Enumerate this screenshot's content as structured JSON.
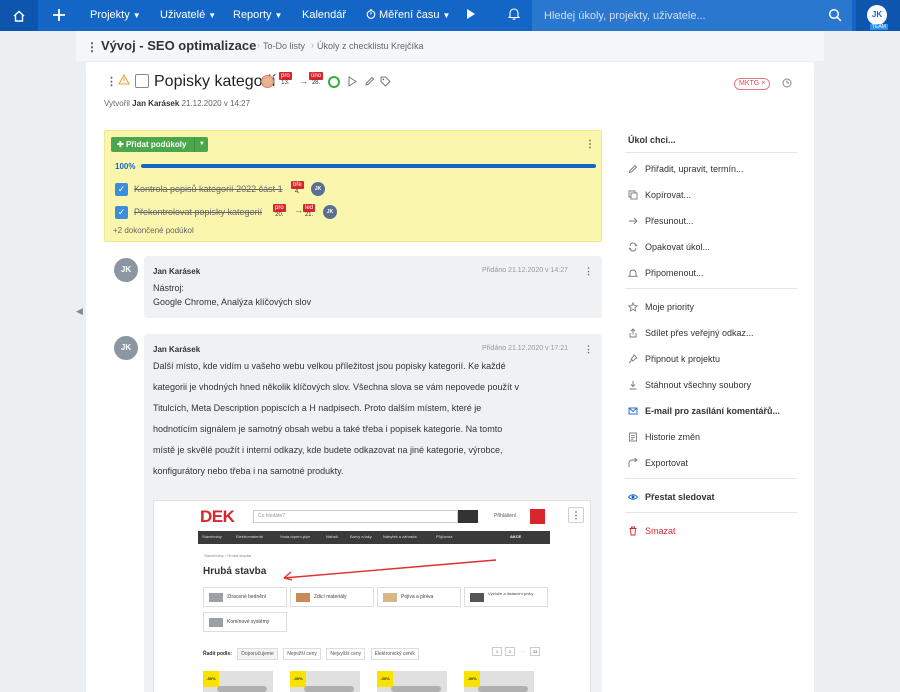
{
  "topbar": {
    "nav": [
      {
        "label": "Projekty",
        "has_menu": true
      },
      {
        "label": "Uživatelé",
        "has_menu": true
      },
      {
        "label": "Reporty",
        "has_menu": true
      },
      {
        "label": "Kalendář",
        "has_menu": false
      },
      {
        "label": "Měření času",
        "has_menu": true
      }
    ],
    "search_placeholder": "Hledej úkoly, projekty, uživatele...",
    "user_initials": "JK",
    "user_badge": "TEAM",
    "colors": {
      "bar": "#1466c6",
      "dark": "#0d55ad"
    }
  },
  "breadcrumb": {
    "title": "Vývoj - SEO optimalizace",
    "links": [
      "To-Do listy",
      "Úkoly z checklistu Krejčíka"
    ]
  },
  "task": {
    "title": "Popisky kategorií",
    "start": {
      "month": "pro",
      "day": "13."
    },
    "end": {
      "month": "úno",
      "day": "28."
    },
    "badge": "MKTG",
    "created_prefix": "Vytvořil",
    "created_by": "Jan Karásek",
    "created_at": "21.12.2020 v 14:27"
  },
  "subtasks": {
    "add_label": "Přidat podúkoly",
    "progress_label": "100%",
    "progress": 1.0,
    "items": [
      {
        "label": "Kontrola popisů kategorií 2022 část 1",
        "done": true,
        "date_month": "bře",
        "date_day": "4.",
        "assignee": "JK"
      },
      {
        "label": "Překontrolovat popisky kategorií",
        "done": true,
        "start_month": "pro",
        "start_day": "20.",
        "date_month": "led",
        "date_day": "21.",
        "assignee": "JK"
      }
    ],
    "more": "+2 dokončené podúkol"
  },
  "comments": [
    {
      "author": "Jan Karásek",
      "initials": "JK",
      "date": "Přidáno 21.12.2020 v 14:27",
      "lines": [
        "Nástroj:",
        "Google Chrome, Analýza klíčových slov"
      ]
    },
    {
      "author": "Jan Karásek",
      "initials": "JK",
      "date": "Přidáno 21.12.2020 v 17:21",
      "lines": [
        "Další místo, kde vidím u vašeho webu velkou příležitost jsou popisky kategorií. Ke každé",
        "kategorii je vhodných hned několik klíčových slov. Všechna slova se vám nepovede použít v",
        "Titulcích, Meta Description popiscích a H nadpisech. Proto dalším místem, které je",
        "hodnotícím signálem je samotný obsah webu a také třeba i popisek kategorie. Na tomto",
        "místě je skvělé použít i interní odkazy, kde budete odkazovat na jiné kategorie, výrobce,",
        "konfigurátory nebo třeba i na samotné produkty."
      ]
    }
  ],
  "attachment": {
    "logo": "DEK",
    "search_placeholder": "Co hledáte?",
    "login": "Přihlášení",
    "nav": [
      "Stavebniny",
      "Elektromateriál",
      "Voda-topení-plyn",
      "Nářadí",
      "Barvy a laky",
      "Nábytek a zahrada",
      "Půjčovna",
      "AKCE"
    ],
    "crumb": "Stavebniny  ›  Hrubá stavba",
    "heading": "Hrubá stavba",
    "tiles": [
      "Ztracené bednění",
      "Zdicí materiály",
      "Pojiva a plniva",
      "Výztuže a distanční prvky",
      "Komínové systémy"
    ],
    "sort_label": "Řadit podle:",
    "sort_options": [
      "Doporučujeme",
      "Nejnižší ceny",
      "Nejvyšší ceny",
      "Elektronický ceník"
    ],
    "pager": [
      "1",
      "2",
      "...",
      "33"
    ],
    "sale_label": "-30%"
  },
  "sidebar": {
    "heading": "Úkol chci...",
    "groups": [
      [
        {
          "label": "Přiřadit, upravit, termín...",
          "icon": "pencil-icon"
        },
        {
          "label": "Kopírovat...",
          "icon": "copy-icon"
        },
        {
          "label": "Přesunout...",
          "icon": "arrow-right-icon"
        },
        {
          "label": "Opakovat úkol...",
          "icon": "repeat-icon"
        },
        {
          "label": "Připomenout...",
          "icon": "bell-icon"
        }
      ],
      [
        {
          "label": "Moje priority",
          "icon": "star-icon"
        },
        {
          "label": "Sdílet přes veřejný odkaz...",
          "icon": "share-icon"
        },
        {
          "label": "Připnout k projektu",
          "icon": "pin-icon"
        },
        {
          "label": "Stáhnout všechny soubory",
          "icon": "download-icon"
        },
        {
          "label": "E-mail pro zasílání komentářů...",
          "icon": "mail-icon",
          "bold": true
        },
        {
          "label": "Historie změn",
          "icon": "history-icon"
        },
        {
          "label": "Exportovat",
          "icon": "export-icon"
        }
      ],
      [
        {
          "label": "Přestat sledovat",
          "icon": "eye-icon",
          "bold": true
        }
      ],
      [
        {
          "label": "Smazat",
          "icon": "trash-icon",
          "danger": true
        }
      ]
    ]
  }
}
